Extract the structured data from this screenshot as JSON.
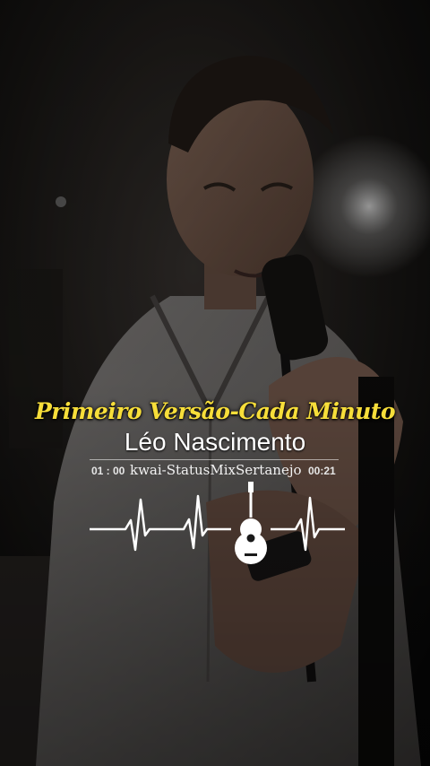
{
  "overlay": {
    "song_title": "Primeiro Versão-Cada Minuto",
    "artist": "Léo Nascimento",
    "elapsed_time": "01 : 00",
    "source_credit": "kwai-StatusMixSertanejo",
    "total_time": "00:21"
  },
  "colors": {
    "title": "#f7de3a",
    "artist": "#ffffff",
    "background": "#0a0a0a"
  },
  "icons": [
    "heartbeat-line-icon",
    "guitar-icon"
  ]
}
